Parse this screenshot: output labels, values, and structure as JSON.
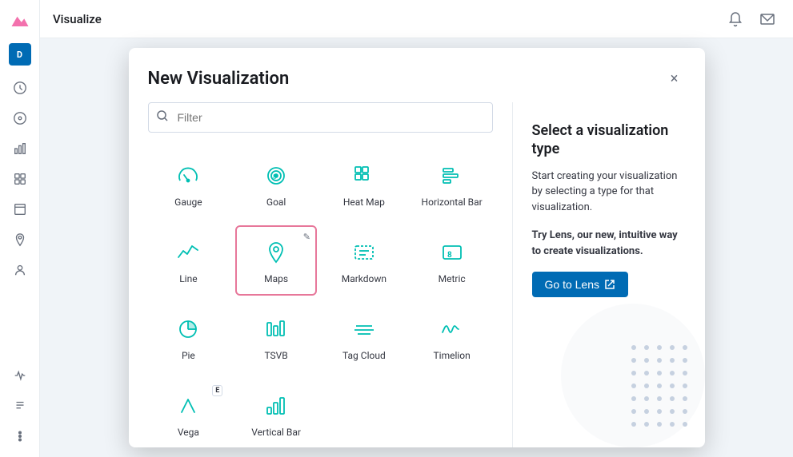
{
  "app": {
    "title": "Visualize",
    "logo_letter": "D"
  },
  "topbar": {
    "title": "Visualize"
  },
  "modal": {
    "title": "New Visualization",
    "filter_placeholder": "Filter",
    "close_label": "×",
    "panel": {
      "title": "Select a visualization type",
      "description": "Start creating your visualization by selecting a type for that visualization.",
      "lens_description": "Try Lens, our new, intuitive way to create visualizations.",
      "go_to_lens": "Go to Lens"
    },
    "visualizations": [
      {
        "id": "gauge",
        "label": "Gauge",
        "icon": "gauge"
      },
      {
        "id": "goal",
        "label": "Goal",
        "icon": "goal"
      },
      {
        "id": "heat-map",
        "label": "Heat Map",
        "icon": "heat-map"
      },
      {
        "id": "horizontal-bar",
        "label": "Horizontal Bar",
        "icon": "horizontal-bar"
      },
      {
        "id": "line",
        "label": "Line",
        "icon": "line"
      },
      {
        "id": "maps",
        "label": "Maps",
        "icon": "maps",
        "selected": true,
        "edit_icon": true
      },
      {
        "id": "markdown",
        "label": "Markdown",
        "icon": "markdown"
      },
      {
        "id": "metric",
        "label": "Metric",
        "icon": "metric"
      },
      {
        "id": "pie",
        "label": "Pie",
        "icon": "pie"
      },
      {
        "id": "tsvb",
        "label": "TSVB",
        "icon": "tsvb"
      },
      {
        "id": "tag-cloud",
        "label": "Tag Cloud",
        "icon": "tag-cloud"
      },
      {
        "id": "timelion",
        "label": "Timelion",
        "icon": "timelion"
      },
      {
        "id": "vega",
        "label": "Vega",
        "icon": "vega",
        "badge": "E"
      },
      {
        "id": "vertical-bar",
        "label": "Vertical Bar",
        "icon": "vertical-bar"
      }
    ]
  },
  "sidebar": {
    "items": [
      {
        "id": "clock",
        "label": "Clock"
      },
      {
        "id": "discover",
        "label": "Discover"
      },
      {
        "id": "visualize",
        "label": "Visualize"
      },
      {
        "id": "dashboard",
        "label": "Dashboard"
      },
      {
        "id": "canvas",
        "label": "Canvas"
      },
      {
        "id": "maps-nav",
        "label": "Maps"
      },
      {
        "id": "users",
        "label": "Users"
      },
      {
        "id": "apm",
        "label": "APM"
      },
      {
        "id": "logs",
        "label": "Logs"
      },
      {
        "id": "more",
        "label": "More"
      }
    ]
  }
}
